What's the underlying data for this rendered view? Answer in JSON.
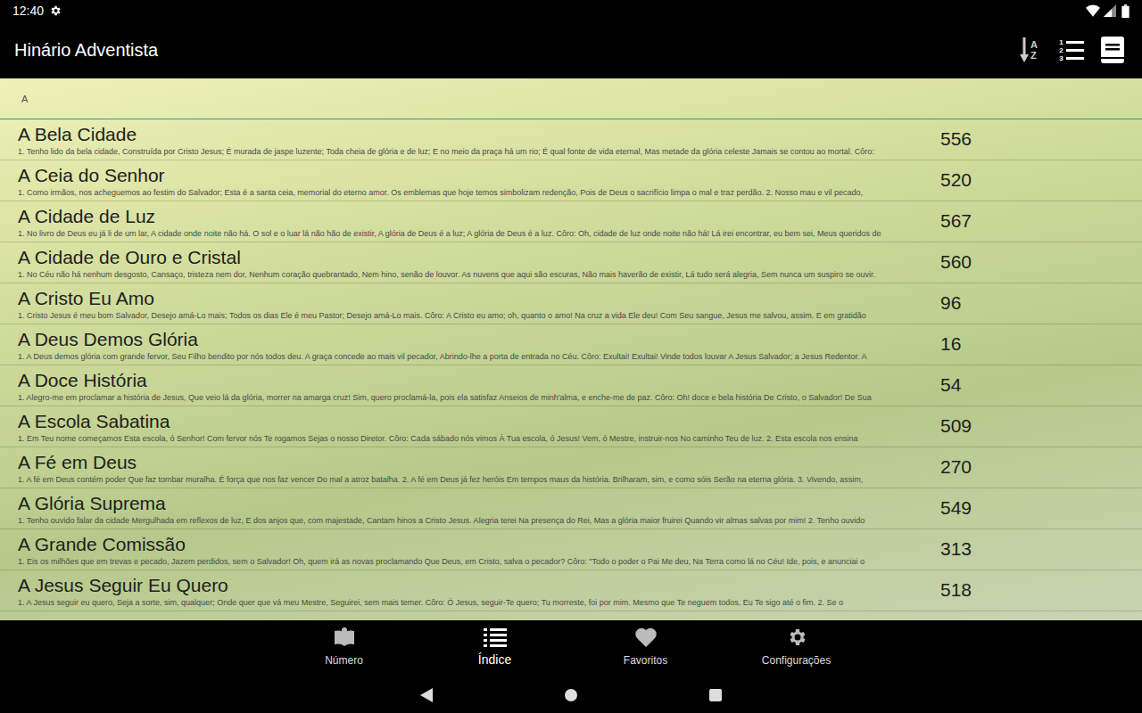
{
  "status_bar": {
    "time": "12:40"
  },
  "app_bar": {
    "title": "Hinário Adventista",
    "sort_letters": [
      "A",
      "Z"
    ],
    "list_numbers": [
      "1",
      "2",
      "3"
    ]
  },
  "section_header": "A",
  "hymns": [
    {
      "title": "A Bela Cidade",
      "number": "556",
      "lyrics": "1. Tenho lido da bela cidade, Construída por Cristo Jesus; É murada de jaspe luzente; Toda cheia de glória e de luz; E no meio da praça há um rio; É qual fonte de vida eternal, Mas metade da glória celeste Jamais se contou ao mortal.  Côro:"
    },
    {
      "title": "A Ceia do Senhor",
      "number": "520",
      "lyrics": "1. Como irmãos, nos acheguemos ao festim do Salvador; Esta é a santa ceia, memorial do eterno amor. Os emblemas que hoje temos simbolizam redenção, Pois de Deus o sacrifício limpa o mal e traz perdão.  2. Nosso mau e vil pecado,"
    },
    {
      "title": "A Cidade de Luz",
      "number": "567",
      "lyrics": "1. No livro de Deus eu já li de um lar, A cidade onde noite não há. O sol e o luar lá não hão de existir, A glória de Deus é a luz; A glória de Deus é a luz.  Côro: Oh, cidade de luz onde noite não há! Lá irei encontrar, eu bem sei, Meus queridos de"
    },
    {
      "title": "A Cidade de Ouro e Cristal",
      "number": "560",
      "lyrics": "1. No Céu não há nenhum desgosto, Cansaço, tristeza nem dor, Nenhum coração quebrantado, Nem hino, senão de louvor. As nuvens que aqui são escuras, Não mais haverão de existir, Lá tudo será alegria, Sem nunca um suspiro se ouvir."
    },
    {
      "title": "A Cristo Eu Amo",
      "number": "96",
      "lyrics": "1. Cristo Jesus é meu bom Salvador, Desejo amá-Lo mais; Todos os dias Ele é meu Pastor; Desejo amá-Lo mais.  Côro: A Cristo eu amo; oh, quanto o amo! Na cruz a vida Ele deu! Com Seu sangue, Jesus me salvou, assim. E em gratidão"
    },
    {
      "title": "A Deus Demos Glória",
      "number": "16",
      "lyrics": "1. A Deus demos glória com grande fervor, Seu Filho bendito por nós todos deu. A graça concede ao mais vil pecador, Abrindo-lhe a porta de entrada no Céu.  Côro: Exultai! Exultai! Vinde todos louvar A Jesus Salvador; a Jesus Redentor. A"
    },
    {
      "title": "A Doce História",
      "number": "54",
      "lyrics": "1. Alegro-me em proclamar a história de Jesus, Que veio lá da glória, morrer na amarga cruz! Sim, quero proclamá-la, pois ela satisfaz Anseios de minh'alma, e enche-me de paz.  Côro: Oh! doce e bela história De Cristo, o Salvador! De Sua"
    },
    {
      "title": "A Escola Sabatina",
      "number": "509",
      "lyrics": "1. Em Teu nome começamos Esta escola, ó Senhor! Com fervor nós Te rogamos Sejas o nosso Diretor.  Côro: Cada sábado nós vimos À Tua escola, ó Jesus! Vem, ó Mestre, instruir-nos No caminho Teu de luz.  2. Esta escola nos ensina"
    },
    {
      "title": "A Fé em Deus",
      "number": "270",
      "lyrics": "1. A fé em Deus contém poder Que faz tombar muralha. É força que nos faz vencer Do mal a atroz batalha.  2. A fé em Deus já fez heróis Em tempos maus da história. Brilharam, sim, e como sóis Serão na eterna glória.  3. Vivendo, assim,"
    },
    {
      "title": "A Glória Suprema",
      "number": "549",
      "lyrics": "1. Tenho ouvido falar da cidade Mergulhada em reflexos de luz, E dos anjos que, com majestade, Cantam hinos a Cristo Jesus. Alegria terei Na presença do Rei, Mas a glória maior fruirei Quando vir almas salvas por mim!  2. Tenho ouvido"
    },
    {
      "title": "A Grande Comissão",
      "number": "313",
      "lyrics": "1. Eis os milhões que em trevas e pecado, Jazem perdidos, sem o Salvador! Oh, quem irá as novas proclamando Que Deus, em Cristo, salva o pecador?  Côro: \"Todo o poder o Pai Me deu, Na Terra como lá no Céu! Ide, pois, e anunciai o"
    },
    {
      "title": "A Jesus Seguir Eu Quero",
      "number": "518",
      "lyrics": "1. A Jesus seguir eu quero, Seja a sorte, sim, qualquer; Onde quer que vá meu Mestre, Seguirei, sem mais temer.  Côro: Ó Jesus, seguir-Te quero; Tu morreste, foi por mim. Mesmo que Te neguem todos, Eu Te sigo até o fim.  2. Se o"
    }
  ],
  "bottom_nav": [
    {
      "label": "Número",
      "selected": false
    },
    {
      "label": "Índice",
      "selected": true
    },
    {
      "label": "Favoritos",
      "selected": false
    },
    {
      "label": "Configurações",
      "selected": false
    }
  ]
}
